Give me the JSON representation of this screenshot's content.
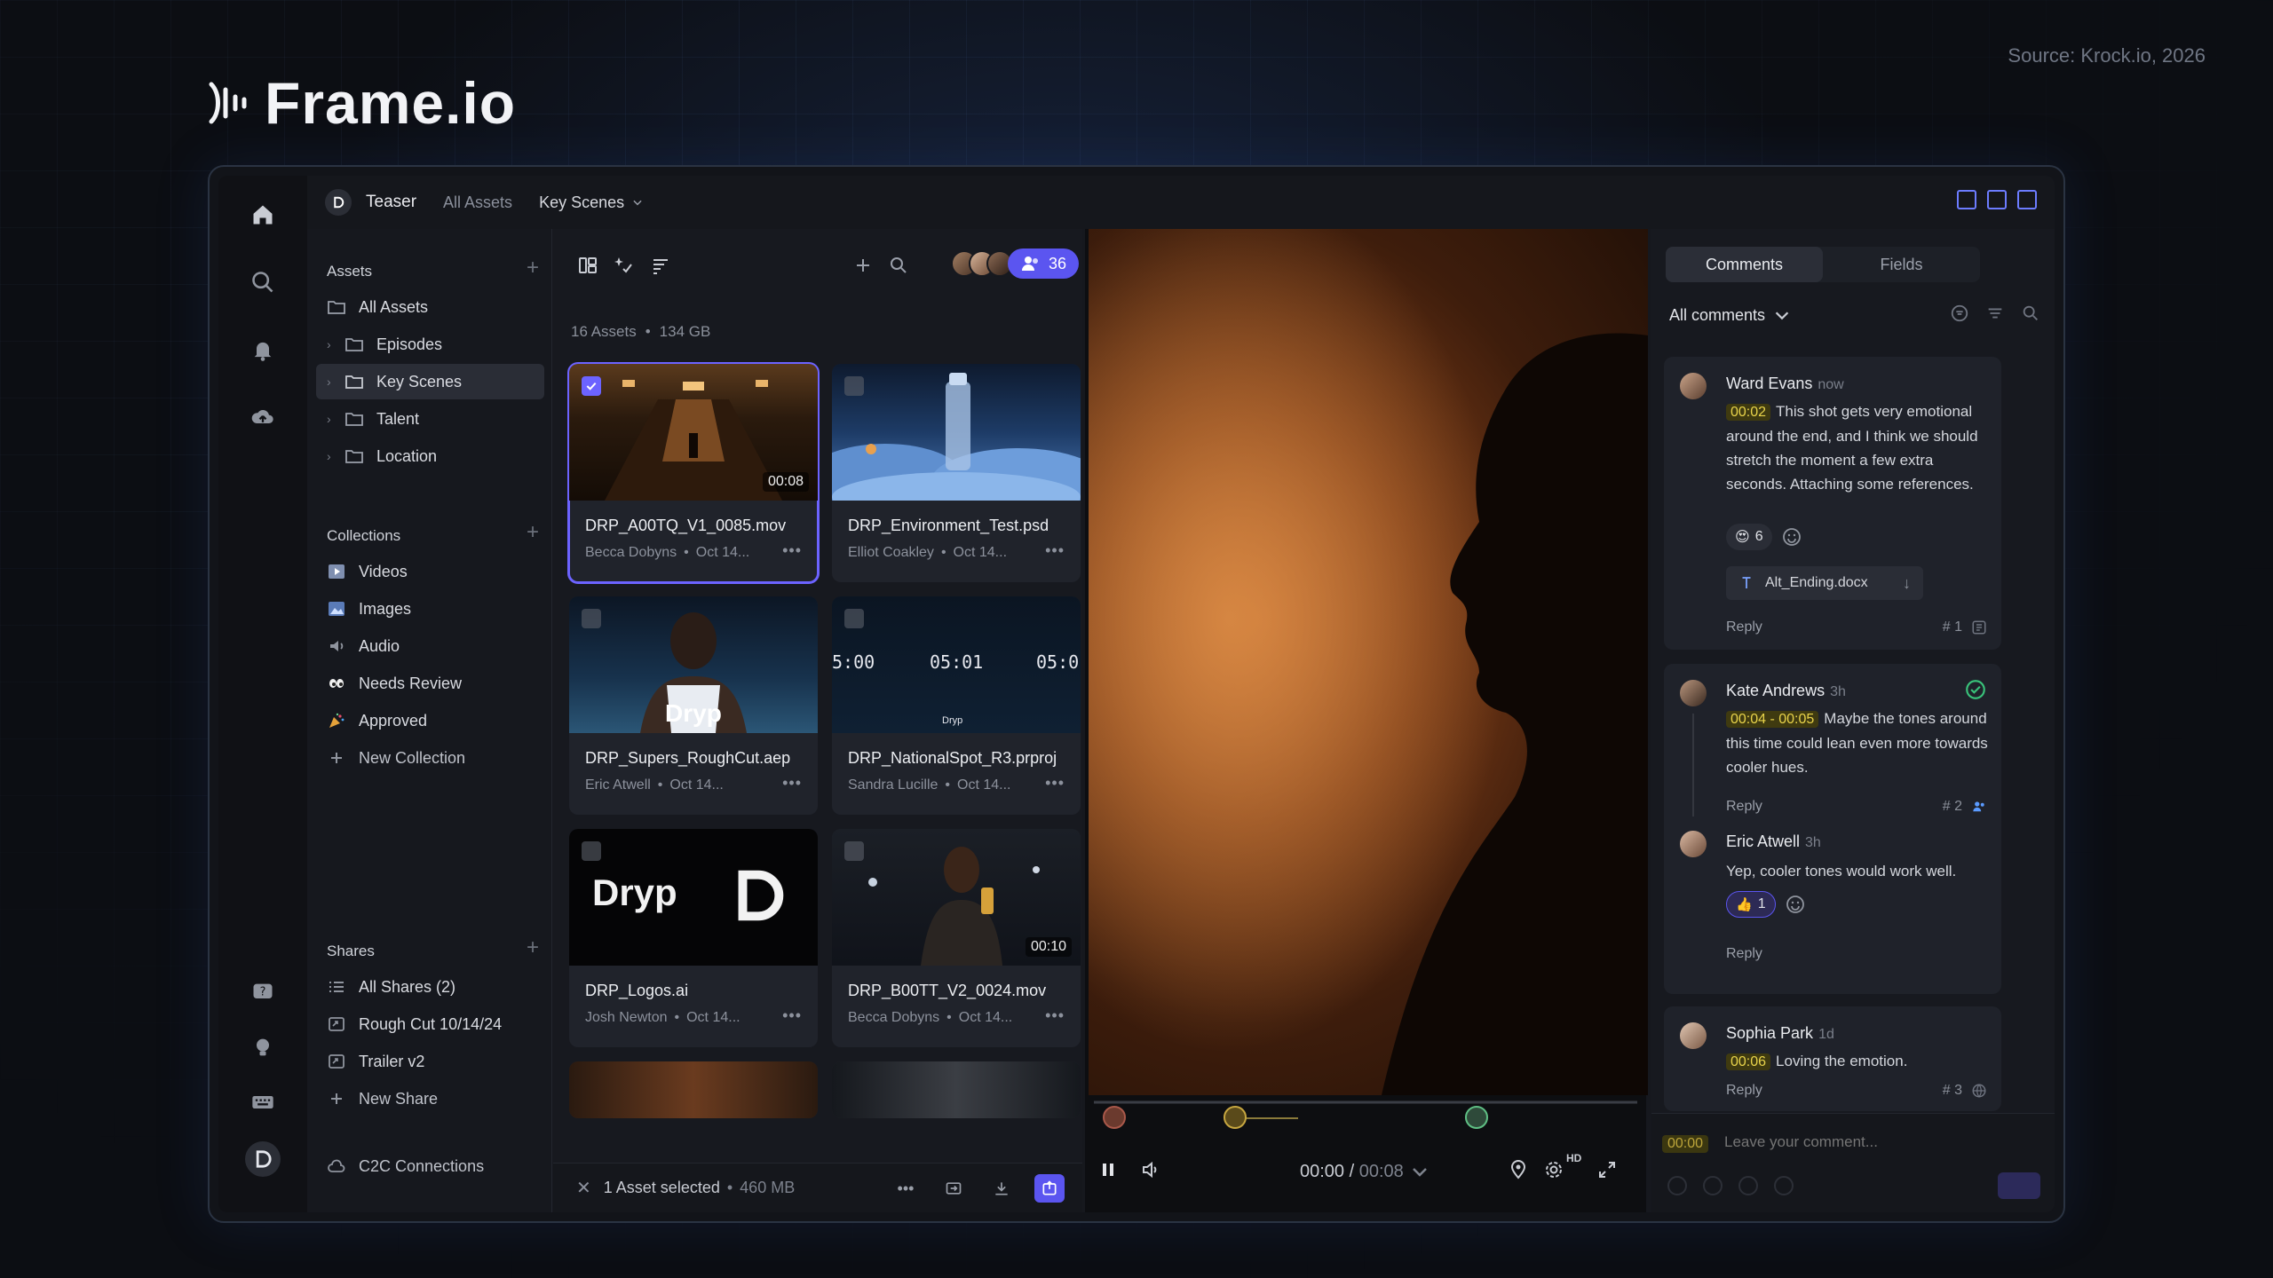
{
  "source_note": "Source: Krock.io, 2026",
  "brand": {
    "name": "Frame.io"
  },
  "topbar": {
    "project": "Teaser",
    "crumb": "All Assets",
    "current": "Key Scenes"
  },
  "sidebar": {
    "assets_title": "Assets",
    "assets": [
      {
        "label": "All Assets"
      },
      {
        "label": "Episodes"
      },
      {
        "label": "Key Scenes"
      },
      {
        "label": "Talent"
      },
      {
        "label": "Location"
      }
    ],
    "collections_title": "Collections",
    "collections": [
      {
        "label": "Videos"
      },
      {
        "label": "Images"
      },
      {
        "label": "Audio"
      },
      {
        "label": "Needs Review"
      },
      {
        "label": "Approved"
      },
      {
        "label": "New Collection"
      }
    ],
    "shares_title": "Shares",
    "shares": [
      {
        "label": "All Shares (2)"
      },
      {
        "label": "Rough Cut 10/14/24"
      },
      {
        "label": "Trailer v2"
      },
      {
        "label": "New Share"
      }
    ],
    "c2c": "C2C Connections"
  },
  "assets_panel": {
    "member_count": "36",
    "asset_count": "16 Assets",
    "total_size": "134 GB",
    "cards": [
      {
        "name": "DRP_A00TQ_V1_0085.mov",
        "owner": "Becca Dobyns",
        "date": "Oct 14...",
        "duration": "00:08"
      },
      {
        "name": "DRP_Environment_Test.psd",
        "owner": "Elliot Coakley",
        "date": "Oct 14..."
      },
      {
        "name": "DRP_Supers_RoughCut.aep",
        "owner": "Eric Atwell",
        "date": "Oct 14..."
      },
      {
        "name": "DRP_NationalSpot_R3.prproj",
        "owner": "Sandra Lucille",
        "date": "Oct 14..."
      },
      {
        "name": "DRP_Logos.ai",
        "owner": "Josh Newton",
        "date": "Oct 14..."
      },
      {
        "name": "DRP_B00TT_V2_0024.mov",
        "owner": "Becca Dobyns",
        "date": "Oct 14...",
        "duration": "00:10"
      }
    ],
    "thumb_text": {
      "dryp": "Dryp",
      "dryp_small": "Dryp",
      "tc1": "5:00",
      "tc2": "05:01",
      "tc3": "05:0"
    },
    "selection": "1 Asset selected",
    "selection_size": "460 MB"
  },
  "player": {
    "current_time": "00:00",
    "total_time": "00:08",
    "quality": "HD",
    "playhead_position": 0.25
  },
  "comments_panel": {
    "tabs": [
      "Comments",
      "Fields"
    ],
    "filter": "All comments",
    "comments": [
      {
        "author": "Ward Evans",
        "ago": "now",
        "timecode": "00:02",
        "text": "This shot gets very emotional around the end, and I think we should stretch the moment a few extra seconds. Attaching some references.",
        "reaction_count": "6",
        "attachment": "Alt_Ending.docx",
        "reply": "Reply",
        "number": "# 1"
      },
      {
        "author": "Kate Andrews",
        "ago": "3h",
        "timecode": "00:04 - 00:05",
        "text": "Maybe the tones around this time could lean even more towards cooler hues.",
        "reply": "Reply",
        "number": "# 2"
      },
      {
        "author": "Eric Atwell",
        "ago": "3h",
        "text": "Yep, cooler tones would work well.",
        "reaction_count": "1",
        "reply": "Reply"
      },
      {
        "author": "Sophia Park",
        "ago": "1d",
        "timecode": "00:06",
        "text": "Loving the emotion.",
        "reply": "Reply",
        "number": "# 3"
      }
    ],
    "composer": {
      "timecode": "00:00",
      "placeholder": "Leave your comment..."
    }
  },
  "colors": {
    "accent": "#5b55f0",
    "timecode_bg": "#3f3a10",
    "timecode_fg": "#e8d34a",
    "bg": "#0c0e13"
  }
}
